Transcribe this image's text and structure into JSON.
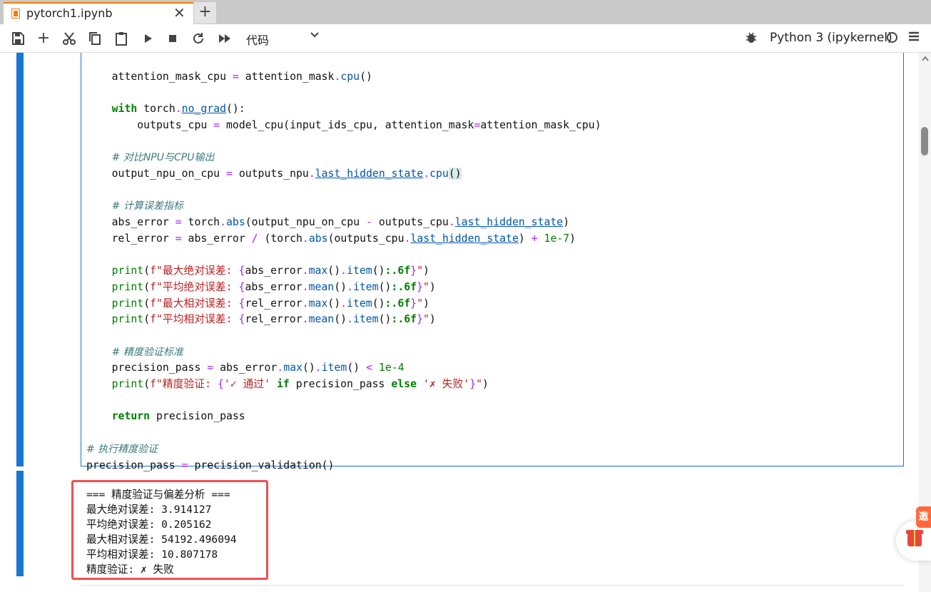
{
  "tab": {
    "title": "pytorch1.ipynb",
    "close": "✕",
    "new": "+"
  },
  "toolbar": {
    "cell_type": "代码",
    "kernel": "Python 3 (ipykernel)"
  },
  "output": {
    "lines": [
      "=== 精度验证与偏差分析 ===",
      "最大绝对误差: 3.914127",
      "平均绝对误差: 0.205162",
      "最大相对误差: 54192.496094",
      "平均相对误差: 10.807178",
      "精度验证: ✗ 失败"
    ]
  },
  "widgets": {
    "invite_label": "邀"
  },
  "colors": {
    "accent": "#1976d2",
    "highlight": "#f05050",
    "tab_accent": "#f57c00"
  }
}
